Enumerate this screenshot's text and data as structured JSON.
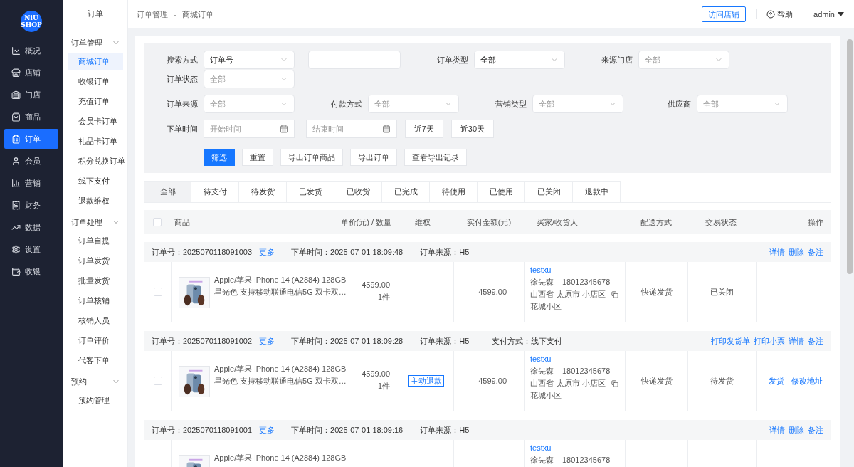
{
  "logo": [
    "NiU",
    "SHOP"
  ],
  "main_nav": [
    {
      "label": "概况",
      "selected": false
    },
    {
      "label": "店铺",
      "selected": false
    },
    {
      "label": "门店",
      "selected": false
    },
    {
      "label": "商品",
      "selected": false
    },
    {
      "label": "订单",
      "selected": true
    },
    {
      "label": "会员",
      "selected": false
    },
    {
      "label": "营销",
      "selected": false
    },
    {
      "label": "财务",
      "selected": false
    },
    {
      "label": "数据",
      "selected": false
    },
    {
      "label": "设置",
      "selected": false
    },
    {
      "label": "收银",
      "selected": false
    }
  ],
  "sub_nav": {
    "title": "订单",
    "groups": [
      {
        "label": "订单管理",
        "expanded": true,
        "children": [
          {
            "label": "商城订单",
            "selected": true
          },
          {
            "label": "收银订单",
            "selected": false
          },
          {
            "label": "充值订单",
            "selected": false
          },
          {
            "label": "会员卡订单",
            "selected": false
          },
          {
            "label": "礼品卡订单",
            "selected": false
          },
          {
            "label": "积分兑换订单",
            "selected": false
          },
          {
            "label": "线下支付",
            "selected": false
          },
          {
            "label": "退款维权",
            "selected": false
          }
        ]
      },
      {
        "label": "订单处理",
        "expanded": true,
        "children": [
          {
            "label": "订单自提",
            "selected": false
          },
          {
            "label": "订单发货",
            "selected": false
          },
          {
            "label": "批量发货",
            "selected": false
          },
          {
            "label": "订单核销",
            "selected": false
          },
          {
            "label": "核销人员",
            "selected": false
          },
          {
            "label": "订单评价",
            "selected": false
          },
          {
            "label": "代客下单",
            "selected": false
          }
        ]
      },
      {
        "label": "预约",
        "expanded": true,
        "children": [
          {
            "label": "预约管理",
            "selected": false
          }
        ]
      }
    ]
  },
  "breadcrumb": {
    "items": [
      "订单管理",
      "商城订单"
    ],
    "separator": "-"
  },
  "topbar": {
    "visit_button": "访问店铺",
    "help": "帮助",
    "user": "admin"
  },
  "filters": {
    "rows": [
      [
        {
          "kind": "select",
          "label": "搜索方式",
          "value": "订单号"
        },
        {
          "kind": "input"
        },
        {
          "kind": "select",
          "label": "订单类型",
          "value": "全部"
        },
        {
          "kind": "select",
          "label": "来源门店",
          "placeholder": "全部"
        }
      ],
      [
        {
          "kind": "select",
          "label": "订单状态",
          "placeholder": "全部"
        }
      ],
      [
        {
          "kind": "select",
          "label": "订单来源",
          "placeholder": "全部"
        },
        {
          "kind": "select",
          "label": "付款方式",
          "placeholder": "全部"
        },
        {
          "kind": "select",
          "label": "营销类型",
          "placeholder": "全部"
        },
        {
          "kind": "select",
          "label": "供应商",
          "placeholder": "全部"
        }
      ],
      [
        {
          "kind": "daterange",
          "label": "下单时间",
          "start_placeholder": "开始时间",
          "separator": "-",
          "end_placeholder": "结束时间"
        },
        {
          "kind": "button",
          "label": "近7天"
        },
        {
          "kind": "button",
          "label": "近30天"
        }
      ]
    ],
    "buttons": [
      {
        "label": "筛选",
        "primary": true
      },
      {
        "label": "重置",
        "primary": false
      },
      {
        "label": "导出订单商品",
        "primary": false
      },
      {
        "label": "导出订单",
        "primary": false
      },
      {
        "label": "查看导出记录",
        "primary": false
      }
    ]
  },
  "tabs": [
    {
      "label": "全部",
      "selected": true
    },
    {
      "label": "待支付",
      "selected": false
    },
    {
      "label": "待发货",
      "selected": false
    },
    {
      "label": "已发货",
      "selected": false
    },
    {
      "label": "已收货",
      "selected": false
    },
    {
      "label": "已完成",
      "selected": false
    },
    {
      "label": "待使用",
      "selected": false
    },
    {
      "label": "已使用",
      "selected": false
    },
    {
      "label": "已关闭",
      "selected": false
    },
    {
      "label": "退款中",
      "selected": false
    }
  ],
  "table": {
    "select_all_checked": false,
    "columns": [
      "商品",
      "单价(元) / 数量",
      "维权",
      "实付金额(元)",
      "买家/收货人",
      "配送方式",
      "交易状态",
      "操作"
    ]
  },
  "orders": [
    {
      "number": "订单号：2025070118091003",
      "more": "更多",
      "time": "下单时间：2025-07-01 18:09:48",
      "source": "订单来源：H5",
      "header_actions": [
        "详情",
        "删除",
        "备注"
      ],
      "checked": false,
      "title_lines": [
        "Apple/苹果 iPhone 14 (A2884) 128GB",
        "星光色 支持移动联通电信5G 双卡双…"
      ],
      "price": "4599.00",
      "quantity": "1件",
      "amount": "4599.00",
      "nickname": "testxu",
      "name": "徐先森",
      "phone": "18012345678",
      "address_lines": [
        "山西省-太原市-小店区",
        "花城小区"
      ],
      "delivery": "快递发货",
      "status": "已关闭"
    },
    {
      "number": "订单号：2025070118091002",
      "more": "更多",
      "time": "下单时间：2025-07-01 18:09:28",
      "source": "订单来源：H5",
      "payment": "支付方式：线下支付",
      "header_actions": [
        "打印发货单",
        "打印小票",
        "详情",
        "备注"
      ],
      "checked": false,
      "title_lines": [
        "Apple/苹果 iPhone 14 (A2884) 128GB",
        "星光色 支持移动联通电信5G 双卡双…"
      ],
      "price": "4599.00",
      "quantity": "1件",
      "refund_button": "主动退款",
      "amount": "4599.00",
      "nickname": "testxu",
      "name": "徐先森",
      "phone": "18012345678",
      "address_lines": [
        "山西省-太原市-小店区",
        "花城小区"
      ],
      "delivery": "快递发货",
      "status": "待发货",
      "body_actions": [
        "发货",
        "修改地址"
      ]
    },
    {
      "number": "订单号：2025070118091001",
      "more": "更多",
      "time": "下单时间：2025-07-01 18:09:16",
      "source": "订单来源：H5",
      "header_actions": [
        "详情",
        "删除",
        "备注"
      ],
      "title_lines": [
        "Apple/苹果 iPhone 14 (A2884) 128GB"
      ],
      "nickname": "testxu",
      "name": "徐先森",
      "phone": "18012345678"
    }
  ]
}
